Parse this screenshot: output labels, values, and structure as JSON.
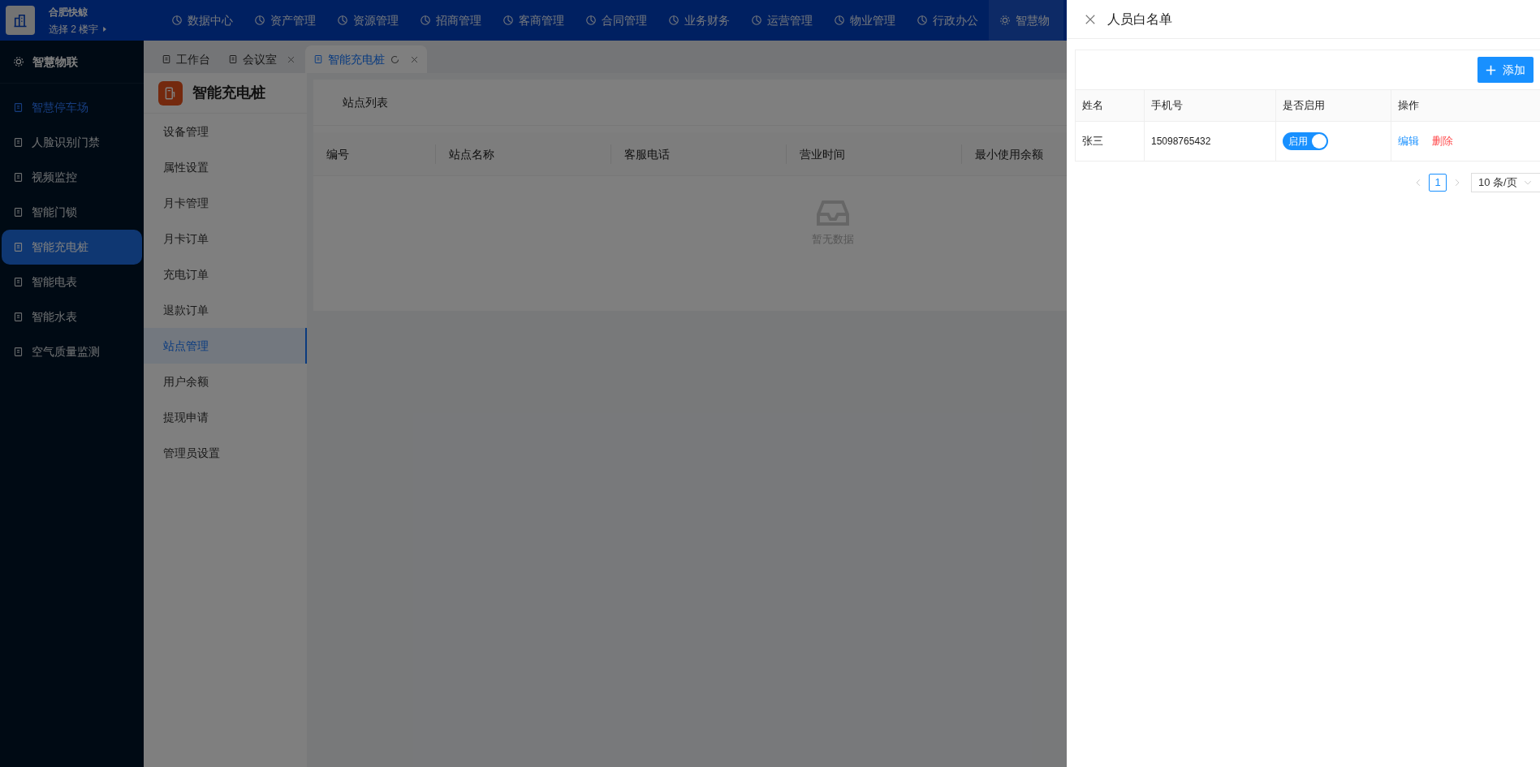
{
  "header": {
    "company": "合肥快鲸",
    "building_selector": "选择 2 楼宇"
  },
  "top_nav": [
    {
      "label": "数据中心",
      "selected": false
    },
    {
      "label": "资产管理",
      "selected": false
    },
    {
      "label": "资源管理",
      "selected": false
    },
    {
      "label": "招商管理",
      "selected": false
    },
    {
      "label": "客商管理",
      "selected": false
    },
    {
      "label": "合同管理",
      "selected": false
    },
    {
      "label": "业务财务",
      "selected": false
    },
    {
      "label": "运营管理",
      "selected": false
    },
    {
      "label": "物业管理",
      "selected": false
    },
    {
      "label": "行政办公",
      "selected": false
    },
    {
      "label": "智慧物",
      "selected": true
    }
  ],
  "sidebar": {
    "title": "智慧物联",
    "items": [
      {
        "label": "智慧停车场",
        "selected": false,
        "highlighted": true
      },
      {
        "label": "人脸识别门禁",
        "selected": false,
        "highlighted": false
      },
      {
        "label": "视频监控",
        "selected": false,
        "highlighted": false
      },
      {
        "label": "智能门锁",
        "selected": false,
        "highlighted": false
      },
      {
        "label": "智能充电桩",
        "selected": true,
        "highlighted": false
      },
      {
        "label": "智能电表",
        "selected": false,
        "highlighted": false
      },
      {
        "label": "智能水表",
        "selected": false,
        "highlighted": false
      },
      {
        "label": "空气质量监测",
        "selected": false,
        "highlighted": false
      }
    ]
  },
  "tabs": [
    {
      "label": "工作台",
      "selected": false,
      "closable": false,
      "refresh": false
    },
    {
      "label": "会议室",
      "selected": false,
      "closable": true,
      "refresh": false
    },
    {
      "label": "智能充电桩",
      "selected": true,
      "closable": true,
      "refresh": true
    }
  ],
  "module": {
    "title": "智能充电桩",
    "menu": [
      {
        "label": "设备管理",
        "selected": false
      },
      {
        "label": "属性设置",
        "selected": false
      },
      {
        "label": "月卡管理",
        "selected": false
      },
      {
        "label": "月卡订单",
        "selected": false
      },
      {
        "label": "充电订单",
        "selected": false
      },
      {
        "label": "退款订单",
        "selected": false
      },
      {
        "label": "站点管理",
        "selected": true
      },
      {
        "label": "用户余额",
        "selected": false
      },
      {
        "label": "提现申请",
        "selected": false
      },
      {
        "label": "管理员设置",
        "selected": false
      }
    ]
  },
  "content": {
    "card_title": "站点列表",
    "columns": [
      "编号",
      "站点名称",
      "客服电话",
      "营业时间",
      "最小使用余额"
    ],
    "empty_text": "暂无数据"
  },
  "drawer": {
    "title": "人员白名单",
    "add_button": "添加",
    "columns": [
      "姓名",
      "手机号",
      "是否启用",
      "操作"
    ],
    "rows": [
      {
        "name": "张三",
        "phone": "15098765432",
        "enabled": true,
        "switch_label": "启用",
        "actions": [
          "编辑",
          "删除"
        ]
      }
    ],
    "pagination": {
      "pages": [
        {
          "label": "1",
          "selected": true
        }
      ],
      "page_size": "10 条/页"
    }
  }
}
